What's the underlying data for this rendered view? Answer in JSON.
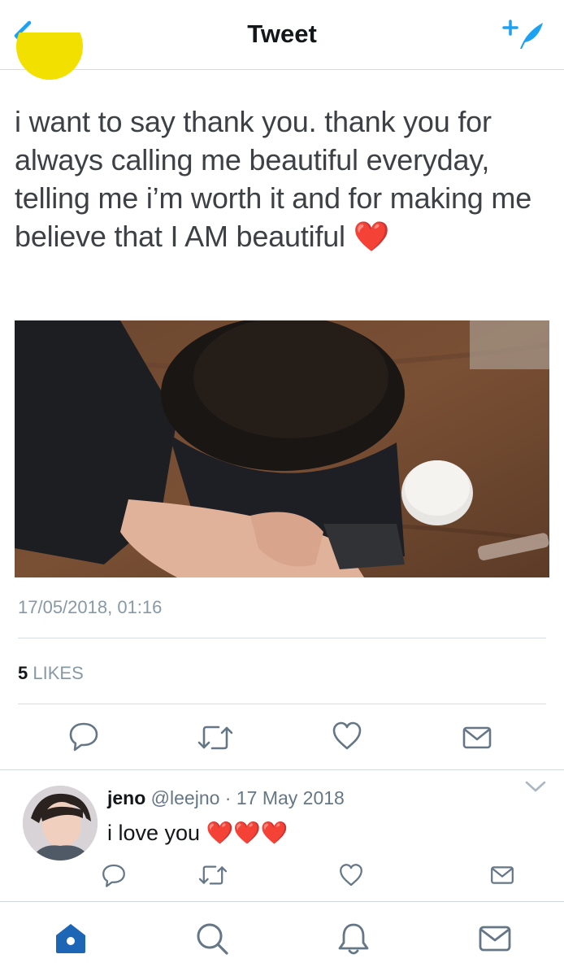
{
  "header": {
    "title": "Tweet",
    "back_icon": "chevron-left-icon",
    "compose_icon": "compose-tweet-icon",
    "accent_color": "#1da1f2"
  },
  "tweet": {
    "text": "i want to say thank you. thank you for always calling me beautiful everyday, telling me i’m worth it and for making me believe that I AM beautiful",
    "emoji": "❤️",
    "timestamp": "17/05/2018, 01:16",
    "likes_count": "5",
    "likes_label": "LIKES",
    "actions": [
      "reply-icon",
      "retweet-icon",
      "like-icon",
      "share-icon"
    ]
  },
  "reply": {
    "name": "jeno",
    "handle": "@leejno",
    "separator": "·",
    "date": "17 May 2018",
    "text": "i love you",
    "emoji": "❤️❤️❤️",
    "actions": [
      "reply-icon",
      "retweet-icon",
      "like-icon",
      "share-icon"
    ]
  },
  "tabbar": {
    "items": [
      "home-icon",
      "search-icon",
      "notifications-icon",
      "messages-icon"
    ],
    "active": "home-icon",
    "active_color": "#1d66b5"
  },
  "colors": {
    "text": "#14171a",
    "secondary": "#8899a6",
    "heart": "#e0162b",
    "icon": "#657786"
  }
}
